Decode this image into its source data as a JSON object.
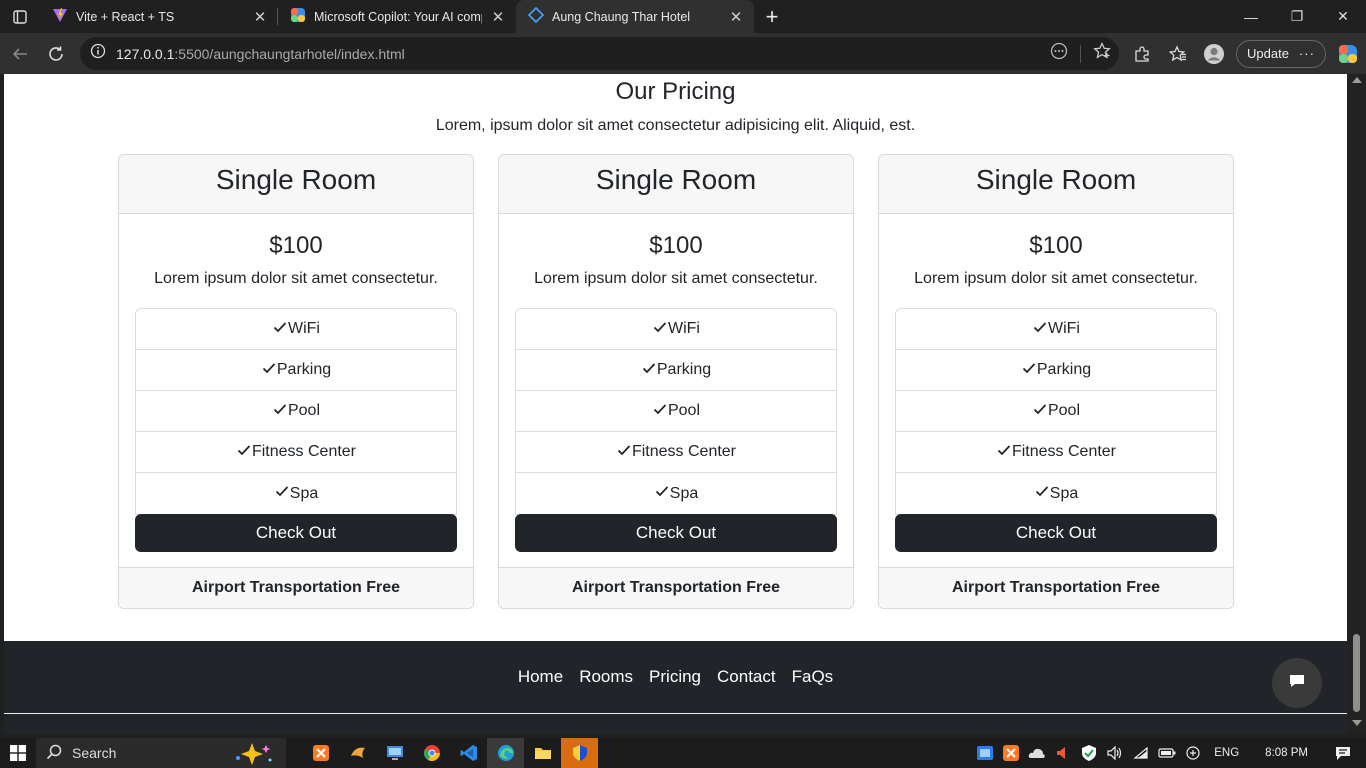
{
  "browser": {
    "tabs": [
      {
        "title": "Vite + React + TS",
        "icon": "vite-icon"
      },
      {
        "title": "Microsoft Copilot: Your AI compa",
        "icon": "copilot-icon"
      },
      {
        "title": "Aung Chaung Thar Hotel",
        "icon": "page-icon",
        "active": true
      }
    ],
    "url_host": "127.0.0.1",
    "url_path": ":5500/aungchaungtarhotel/index.html",
    "update_label": "Update"
  },
  "pricing": {
    "title": "Our Pricing",
    "subtitle": "Lorem, ipsum dolor sit amet consectetur adipisicing elit. Aliquid, est.",
    "cards": [
      {
        "header": "Single Room",
        "price": "$100",
        "description": "Lorem ipsum dolor sit amet consectetur.",
        "features": [
          "WiFi",
          "Parking",
          "Pool",
          "Fitness Center",
          "Spa"
        ],
        "button": "Check Out",
        "footer": "Airport Transportation Free"
      },
      {
        "header": "Single Room",
        "price": "$100",
        "description": "Lorem ipsum dolor sit amet consectetur.",
        "features": [
          "WiFi",
          "Parking",
          "Pool",
          "Fitness Center",
          "Spa"
        ],
        "button": "Check Out",
        "footer": "Airport Transportation Free"
      },
      {
        "header": "Single Room",
        "price": "$100",
        "description": "Lorem ipsum dolor sit amet consectetur.",
        "features": [
          "WiFi",
          "Parking",
          "Pool",
          "Fitness Center",
          "Spa"
        ],
        "button": "Check Out",
        "footer": "Airport Transportation Free"
      }
    ]
  },
  "footer": {
    "links": [
      "Home",
      "Rooms",
      "Pricing",
      "Contact",
      "FaQs"
    ]
  },
  "taskbar": {
    "search_label": "Search",
    "language": "ENG",
    "time": "8:08 PM"
  },
  "colors": {
    "dark": "#212529",
    "card_header_bg": "#f7f7f7",
    "browser_chrome": "#202020"
  }
}
